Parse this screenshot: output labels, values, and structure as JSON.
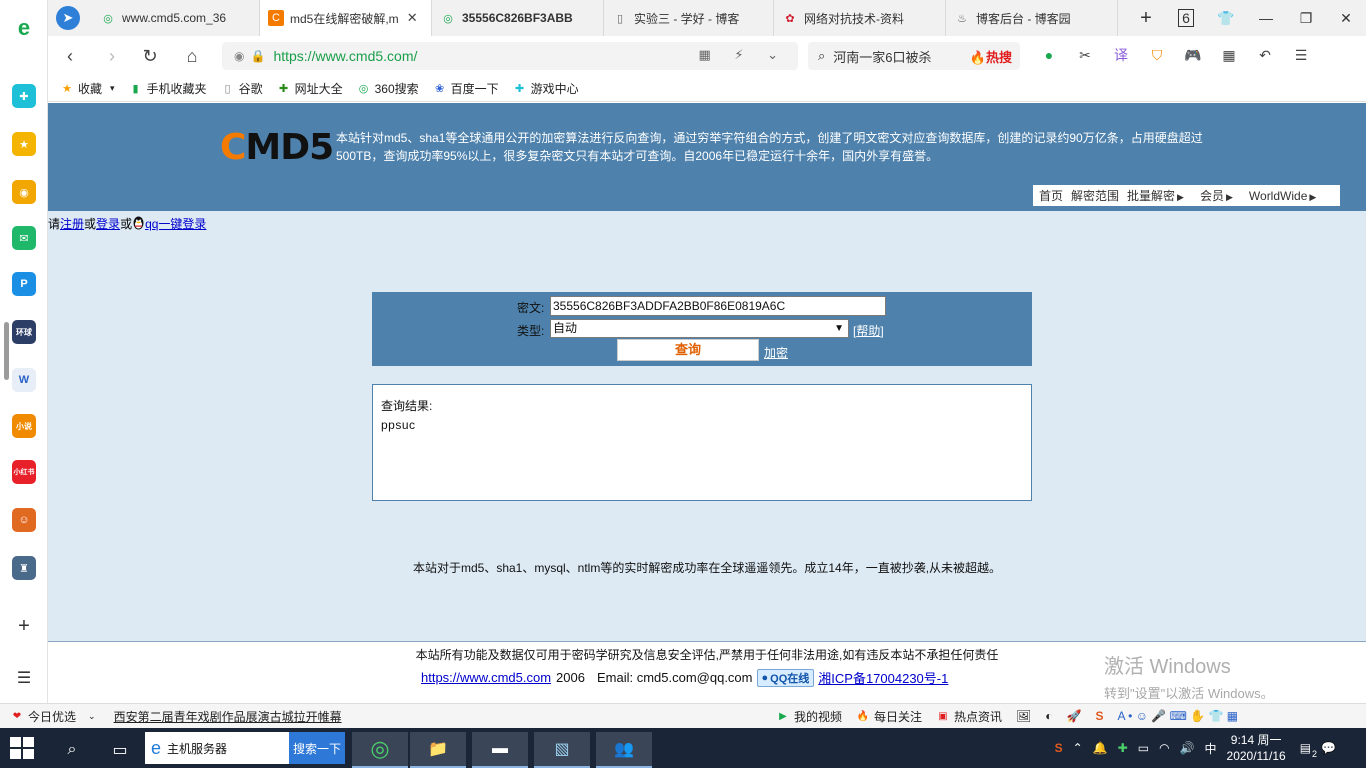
{
  "tabs": [
    {
      "title": "www.cmd5.com_36",
      "active": false
    },
    {
      "title": "md5在线解密破解,m",
      "active": true
    },
    {
      "title": "35556C826BF3ABB",
      "active": false
    },
    {
      "title": "实验三 - 学好 - 博客",
      "active": false
    },
    {
      "title": "网络对抗技术-资料",
      "active": false
    },
    {
      "title": "博客后台 - 博客园",
      "active": false
    }
  ],
  "tab_count": "6",
  "address": {
    "url": "https://www.cmd5.com/",
    "search_text": "河南一家6口被杀",
    "hot_label": "热搜"
  },
  "bookmarks": [
    "收藏",
    "手机收藏夹",
    "谷歌",
    "网址大全",
    "360搜索",
    "百度一下",
    "游戏中心"
  ],
  "site": {
    "logo_c": "C",
    "logo_rest": "MD5",
    "banner_text": "本站针对md5、sha1等全球通用公开的加密算法进行反向查询，通过穷举字符组合的方式，创建了明文密文对应查询数据库，创建的记录约90万亿条，占用硬盘超过500TB，查询成功率95%以上，很多复杂密文只有本站才可查询。自2006年已稳定运行十余年，国内外享有盛誉。",
    "nav": [
      "首页",
      "解密范围",
      "批量解密",
      "会员",
      "WorldWide"
    ]
  },
  "login": {
    "prefix": "请",
    "register": "注册",
    "or1": "或",
    "login": "登录",
    "or2": "或",
    "qq_login": "qq一键登录"
  },
  "form": {
    "cipher_label": "密文:",
    "cipher_value": "35556C826BF3ADDFA2BB0F86E0819A6C",
    "type_label": "类型:",
    "type_value": "自动",
    "help_open": "[",
    "help": "帮助",
    "help_close": "]",
    "query_button": "查询",
    "encrypt_link": "加密"
  },
  "result": {
    "title": "查询结果:",
    "value": "ppsuc"
  },
  "tagline": "本站对于md5、sha1、mysql、ntlm等的实时解密成功率在全球遥遥领先。成立14年，一直被抄袭,从未被超越。",
  "footer": {
    "disclaimer": "本站所有功能及数据仅可用于密码学研究及信息安全评估,严禁用于任何非法用途,如有违反本站不承担任何责任",
    "site_link": "https://www.cmd5.com",
    "year": "2006",
    "email": "Email: cmd5.com@qq.com",
    "qq_online": "QQ在线",
    "icp": "湘ICP备17004230号-1"
  },
  "watermark": {
    "line1": "激活 Windows",
    "line2": "转到\"设置\"以激活 Windows。"
  },
  "infobar": {
    "daily_pick": "今日优选",
    "news": "西安第二届青年戏剧作品展演古城拉开帷幕",
    "my_video": "我的视频",
    "daily_follow": "每日关注",
    "hot_news": "热点资讯"
  },
  "taskbar": {
    "search_text": "主机服务器",
    "search_button": "搜索一下",
    "time": "9:14 周一",
    "date": "2020/11/16",
    "notif_count": "2"
  }
}
